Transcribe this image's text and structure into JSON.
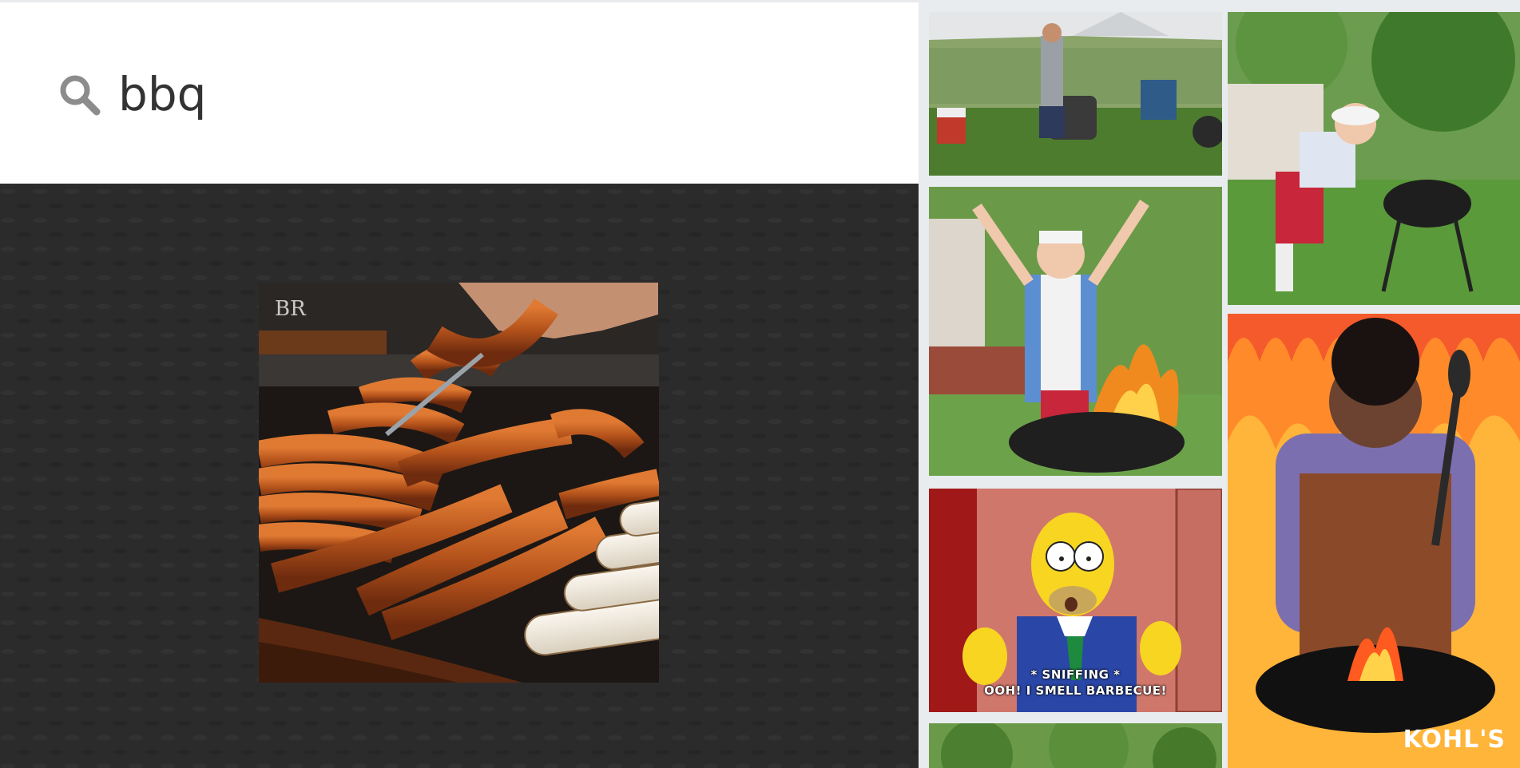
{
  "search": {
    "value": "bbq",
    "icon": "search-icon"
  },
  "viewer": {
    "watermark": "BR"
  },
  "grid": {
    "tiles": [
      {
        "name": "backyard-party-tile"
      },
      {
        "name": "kid-charcoal-bag-tile"
      },
      {
        "name": "grill-flames-cheer-tile"
      },
      {
        "name": "homer-simpson-tile",
        "caption_line1": "* SNIFFING *",
        "caption_line2": "OOH! I SMELL BARBECUE!"
      },
      {
        "name": "kohls-griller-tile",
        "brand": "KOHL'S"
      },
      {
        "name": "trees-partial-tile"
      }
    ]
  },
  "colors": {
    "search_bg": "#ffffff",
    "viewer_bg": "#2b2b2b",
    "grid_bg": "#e9ecee",
    "search_text": "#333333"
  }
}
